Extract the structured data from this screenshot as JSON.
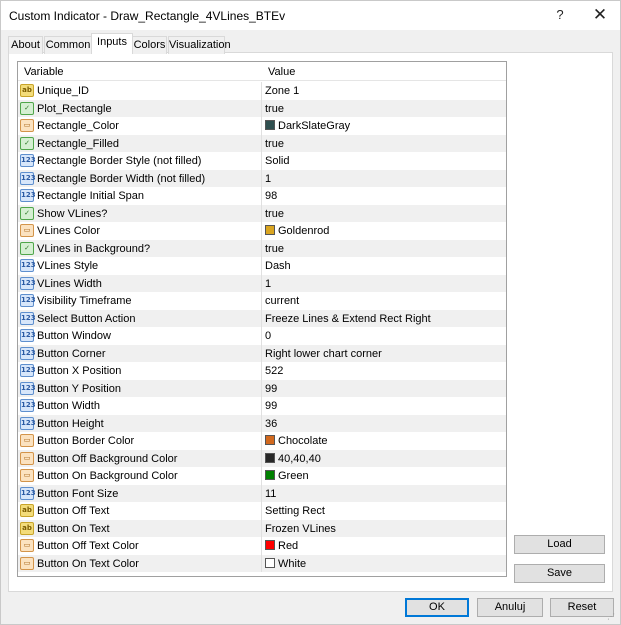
{
  "window": {
    "title": "Custom Indicator - Draw_Rectangle_4VLines_BTEv",
    "help_label": "?",
    "close_label": "✕"
  },
  "tabs": [
    {
      "label": "About"
    },
    {
      "label": "Common"
    },
    {
      "label": "Inputs",
      "active": true
    },
    {
      "label": "Colors"
    },
    {
      "label": "Visualization"
    }
  ],
  "grid": {
    "header": {
      "variable": "Variable",
      "value": "Value"
    },
    "rows": [
      {
        "type": "ab",
        "icon": "string-icon",
        "name": "Unique_ID",
        "value": "Zone 1"
      },
      {
        "type": "bool",
        "icon": "bool-icon",
        "name": "Plot_Rectangle",
        "value": "true"
      },
      {
        "type": "color",
        "icon": "color-icon",
        "name": "Rectangle_Color",
        "value": "DarkSlateGray",
        "swatch": "#2f4f4f"
      },
      {
        "type": "bool",
        "icon": "bool-icon",
        "name": "Rectangle_Filled",
        "value": "true"
      },
      {
        "type": "num",
        "icon": "number-icon",
        "name": "Rectangle Border Style (not filled)",
        "value": "Solid"
      },
      {
        "type": "num",
        "icon": "number-icon",
        "name": "Rectangle Border Width (not filled)",
        "value": "1"
      },
      {
        "type": "num",
        "icon": "number-icon",
        "name": "Rectangle Initial Span",
        "value": "98"
      },
      {
        "type": "bool",
        "icon": "bool-icon",
        "name": "Show VLines?",
        "value": "true"
      },
      {
        "type": "color",
        "icon": "color-icon",
        "name": "VLines Color",
        "value": "Goldenrod",
        "swatch": "#daa520"
      },
      {
        "type": "bool",
        "icon": "bool-icon",
        "name": "VLines in Background?",
        "value": "true"
      },
      {
        "type": "num",
        "icon": "number-icon",
        "name": "VLines Style",
        "value": "Dash"
      },
      {
        "type": "num",
        "icon": "number-icon",
        "name": "VLines Width",
        "value": "1"
      },
      {
        "type": "num",
        "icon": "number-icon",
        "name": "Visibility Timeframe",
        "value": "current"
      },
      {
        "type": "num",
        "icon": "number-icon",
        "name": "Select Button Action",
        "value": "Freeze Lines & Extend Rect Right"
      },
      {
        "type": "num",
        "icon": "number-icon",
        "name": "Button Window",
        "value": "0"
      },
      {
        "type": "num",
        "icon": "number-icon",
        "name": "Button Corner",
        "value": "Right lower chart corner"
      },
      {
        "type": "num",
        "icon": "number-icon",
        "name": "Button X Position",
        "value": "522"
      },
      {
        "type": "num",
        "icon": "number-icon",
        "name": "Button Y Position",
        "value": "99"
      },
      {
        "type": "num",
        "icon": "number-icon",
        "name": "Button Width",
        "value": "99"
      },
      {
        "type": "num",
        "icon": "number-icon",
        "name": "Button Height",
        "value": "36"
      },
      {
        "type": "color",
        "icon": "color-icon",
        "name": "Button Border Color",
        "value": "Chocolate",
        "swatch": "#d2691e"
      },
      {
        "type": "color",
        "icon": "color-icon",
        "name": "Button Off Background Color",
        "value": "40,40,40",
        "swatch": "#282828"
      },
      {
        "type": "color",
        "icon": "color-icon",
        "name": "Button On Background Color",
        "value": "Green",
        "swatch": "#008000"
      },
      {
        "type": "num",
        "icon": "number-icon",
        "name": "Button Font Size",
        "value": "11"
      },
      {
        "type": "ab",
        "icon": "string-icon",
        "name": "Button Off Text",
        "value": "Setting Rect"
      },
      {
        "type": "ab",
        "icon": "string-icon",
        "name": "Button On Text",
        "value": "Frozen VLines"
      },
      {
        "type": "color",
        "icon": "color-icon",
        "name": "Button Off Text Color",
        "value": "Red",
        "swatch": "#ff0000"
      },
      {
        "type": "color",
        "icon": "color-icon",
        "name": "Button On Text Color",
        "value": "White",
        "swatch": "#ffffff"
      }
    ]
  },
  "side_buttons": {
    "load": "Load",
    "save": "Save"
  },
  "footer": {
    "ok": "OK",
    "cancel": "Anuluj",
    "reset": "Reset"
  },
  "icon_glyphs": {
    "ab": "ab",
    "num": "123",
    "bool": "✓",
    "color": "▭"
  }
}
